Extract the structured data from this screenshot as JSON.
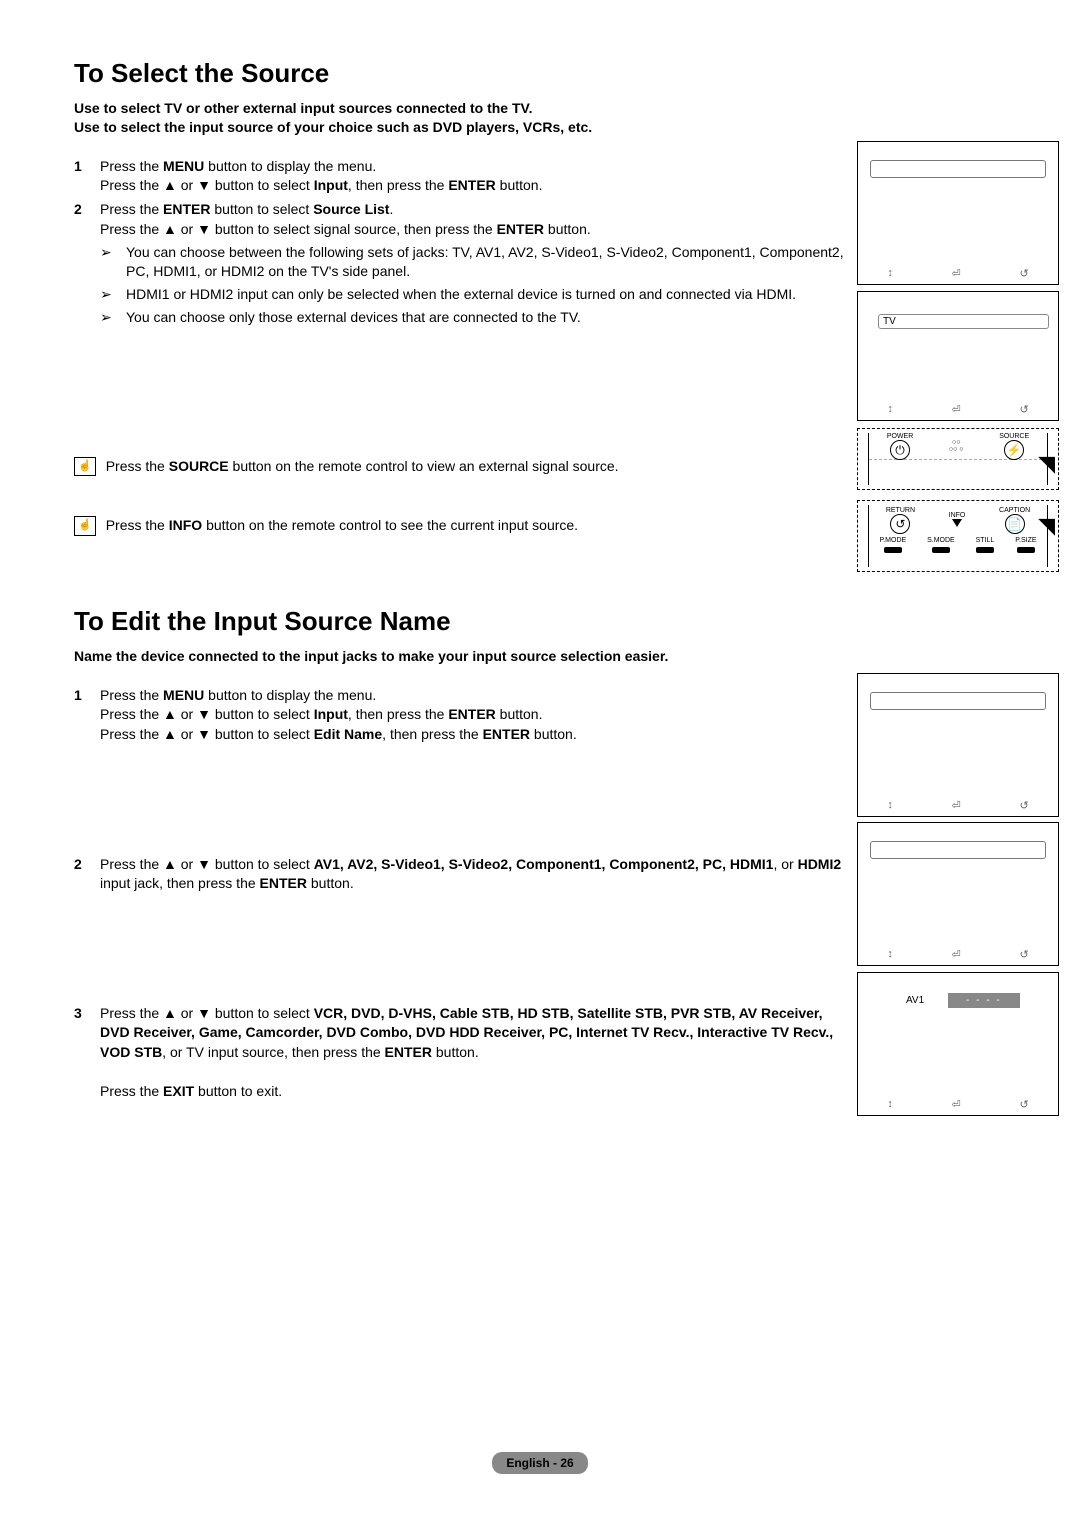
{
  "section1": {
    "title": "To Select the Source",
    "intro1": "Use to select TV or other external input sources connected to the TV.",
    "intro2": "Use to select the input source of your choice such as DVD players, VCRs, etc.",
    "step1_num": "1",
    "step1_a": "Press the ",
    "step1_menu": "MENU",
    "step1_b": " button to display the menu.",
    "step1_c": "Press the ▲ or ▼ button to select ",
    "step1_input": "Input",
    "step1_d": ", then press the ",
    "step1_enter": "ENTER",
    "step1_e": " button.",
    "step2_num": "2",
    "step2_a": "Press the ",
    "step2_enter": "ENTER",
    "step2_b": " button to select ",
    "step2_src": "Source List",
    "step2_c": ".",
    "step2_d": "Press the ▲ or ▼ button to select signal source, then press the ",
    "step2_enter2": "ENTER",
    "step2_e": " button.",
    "bullet1": "You can choose between the following sets of jacks: TV, AV1, AV2, S-Video1, S-Video2, Component1, Component2, PC, HDMI1, or HDMI2 on the TV's side panel.",
    "bullet2": "HDMI1 or HDMI2 input can only be selected when the external device is turned on and connected via HDMI.",
    "bullet3": "You can choose only those external devices that are connected to the TV.",
    "tip1_a": "Press the ",
    "tip1_src": "SOURCE",
    "tip1_b": " button on the remote control to view an external signal source.",
    "tip2_a": "Press the ",
    "tip2_info": "INFO",
    "tip2_b": " button on the remote control to see the current input source."
  },
  "section2": {
    "title": "To Edit the Input Source Name",
    "intro": "Name the device connected to the input jacks to make your input source selection easier.",
    "step1_num": "1",
    "step1_a": "Press the ",
    "step1_menu": "MENU",
    "step1_b": " button to display the menu.",
    "step1_c": "Press the ▲ or ▼ button to select ",
    "step1_input": "Input",
    "step1_d": ", then press the ",
    "step1_enter": "ENTER",
    "step1_e": " button.",
    "step1_f": "Press the ▲ or ▼ button to select ",
    "step1_edit": "Edit Name",
    "step1_g": ", then press the ",
    "step1_enter2": "ENTER",
    "step1_h": " button.",
    "step2_num": "2",
    "step2_a": "Press the ▲ or ▼ button to select ",
    "step2_list": "AV1, AV2, S-Video1, S-Video2, Component1, Component2, PC, HDMI1",
    "step2_b": ", or ",
    "step2_hdmi2": "HDMI2",
    "step2_c": " input jack, then press the ",
    "step2_enter": "ENTER",
    "step2_d": " button.",
    "step3_num": "3",
    "step3_a": "Press the ▲ or ▼ button to select ",
    "step3_list": "VCR, DVD, D-VHS, Cable STB, HD STB, Satellite STB, PVR STB, AV Receiver, DVD Receiver, Game, Camcorder, DVD Combo, DVD HDD Receiver, PC, Internet TV Recv., Interactive TV Recv., VOD STB",
    "step3_b": ", or TV input source, then press the ",
    "step3_enter": "ENTER",
    "step3_c": " button.",
    "step3_exit_a": "Press the ",
    "step3_exit": "EXIT",
    "step3_exit_b": " button to exit."
  },
  "remote": {
    "power": "POWER",
    "source": "SOURCE",
    "return": "RETURN",
    "info": "INFO",
    "caption": "CAPTION",
    "pmode": "P.MODE",
    "smode": "S.MODE",
    "still": "STILL",
    "psize": "P.SIZE"
  },
  "fig": {
    "tv": "TV",
    "av1": "AV1",
    "dash": "- - - -"
  },
  "footer": "English - 26",
  "icons": {
    "move": "↕",
    "enter": "⏎",
    "ret": "↺",
    "tip": "☝"
  }
}
